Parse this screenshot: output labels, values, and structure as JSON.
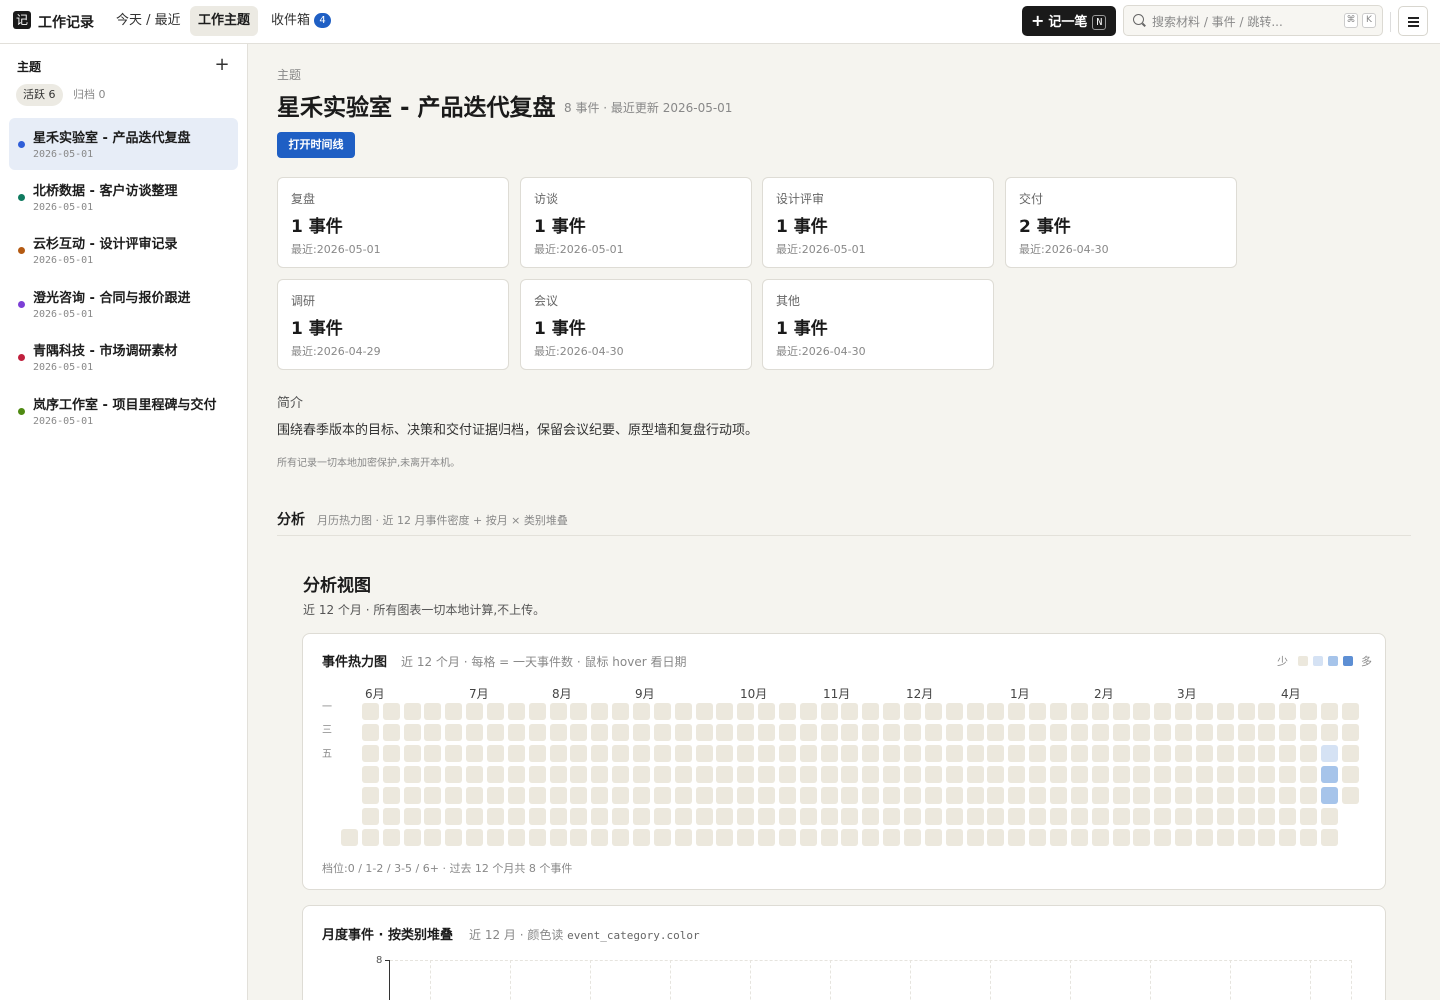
{
  "topbar": {
    "logo_char": "记",
    "app_name": "工作记录",
    "nav": [
      {
        "label": "今天 / 最近",
        "active": false
      },
      {
        "label": "工作主题",
        "active": true
      },
      {
        "label": "收件箱",
        "active": false,
        "badge": "4"
      }
    ],
    "new_label": "记一笔",
    "new_shortcut": "N",
    "search_placeholder": "搜索材料 / 事件 / 跳转...",
    "search_keys": [
      "⌘",
      "K"
    ]
  },
  "sidebar": {
    "title": "主题",
    "filters": [
      {
        "label": "活跃 6",
        "active": true
      },
      {
        "label": "归档 0",
        "active": false
      }
    ],
    "topics": [
      {
        "name": "星禾实验室 - 产品迭代复盘",
        "date": "2026-05-01",
        "color": "#2f5ed8",
        "selected": true
      },
      {
        "name": "北桥数据 - 客户访谈整理",
        "date": "2026-05-01",
        "color": "#0f7a5f",
        "selected": false
      },
      {
        "name": "云杉互动 - 设计评审记录",
        "date": "2026-05-01",
        "color": "#b45a12",
        "selected": false
      },
      {
        "name": "澄光咨询 - 合同与报价跟进",
        "date": "2026-05-01",
        "color": "#7c3fd6",
        "selected": false
      },
      {
        "name": "青隅科技 - 市场调研素材",
        "date": "2026-05-01",
        "color": "#c0203d",
        "selected": false
      },
      {
        "name": "岚序工作室 - 项目里程碑与交付",
        "date": "2026-05-01",
        "color": "#4f8a12",
        "selected": false
      }
    ]
  },
  "main": {
    "crumb": "主题",
    "title": "星禾实验室 - 产品迭代复盘",
    "meta": "8 事件 · 最近更新 2026-05-01",
    "timeline_button": "打开时间线",
    "categories": [
      {
        "label": "复盘",
        "count": "1 事件",
        "latest": "最近:2026-05-01"
      },
      {
        "label": "访谈",
        "count": "1 事件",
        "latest": "最近:2026-05-01"
      },
      {
        "label": "设计评审",
        "count": "1 事件",
        "latest": "最近:2026-05-01"
      },
      {
        "label": "交付",
        "count": "2 事件",
        "latest": "最近:2026-04-30"
      },
      {
        "label": "调研",
        "count": "1 事件",
        "latest": "最近:2026-04-29"
      },
      {
        "label": "会议",
        "count": "1 事件",
        "latest": "最近:2026-04-30"
      },
      {
        "label": "其他",
        "count": "1 事件",
        "latest": "最近:2026-04-30"
      }
    ],
    "intro_heading": "简介",
    "intro_text": "围绕春季版本的目标、决策和交付证据归档，保留会议纪要、原型墙和复盘行动项。",
    "privacy_note": "所有记录一切本地加密保护,未离开本机。"
  },
  "analysis": {
    "heading": "分析",
    "subheading": "月历热力图 · 近 12 月事件密度 + 按月 × 类别堆叠",
    "view_title": "分析视图",
    "view_sub": "近 12 个月 · 所有图表一切本地计算,不上传。"
  },
  "heatmap": {
    "title": "事件热力图",
    "subtitle": "近 12 个月 · 每格 = 一天事件数 · 鼠标 hover 看日期",
    "legend_less": "少",
    "legend_more": "多",
    "legend_colors": [
      "#ece8dd",
      "#d5e2f4",
      "#a6c4ea",
      "#5d8fd4"
    ],
    "months": [
      "6月",
      "7月",
      "8月",
      "9月",
      "10月",
      "11月",
      "12月",
      "1月",
      "2月",
      "3月",
      "4月"
    ],
    "day_labels": [
      "一",
      "三",
      "五"
    ],
    "active_cells": [
      {
        "weekday": "周三",
        "level": 1
      },
      {
        "weekday": "周四",
        "level": 2
      },
      {
        "weekday": "周五",
        "level": 2
      }
    ],
    "footer": "档位:0 / 1-2 / 3-5 / 6+ · 过去 12 个月共 8 个事件"
  },
  "stacked": {
    "title": "月度事件 · 按类别堆叠",
    "subtitle_text": "近 12 月 · 颜色读",
    "subtitle_code": "event_category.color",
    "y_max_label": "8"
  }
}
